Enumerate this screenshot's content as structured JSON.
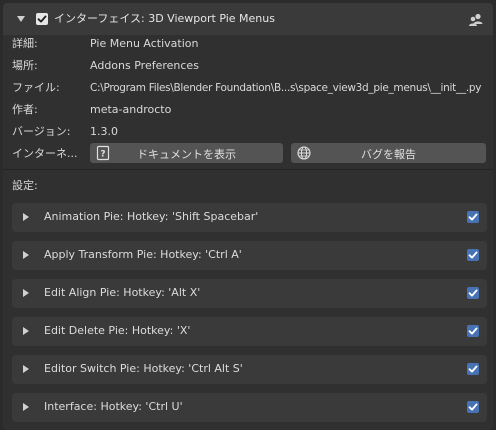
{
  "header": {
    "title": "インターフェイス: 3D Viewport Pie Menus",
    "enabled": true,
    "icon": "user-icon"
  },
  "info": {
    "description_label": "詳細:",
    "description_value": "Pie Menu Activation",
    "location_label": "場所:",
    "location_value": "Addons Preferences",
    "file_label": "ファイル:",
    "file_value": "C:\\Program Files\\Blender Foundation\\B...s\\space_view3d_pie_menus\\__init__.py",
    "author_label": "作者:",
    "author_value": "meta-androcto",
    "version_label": "バージョン:",
    "version_value": "1.3.0",
    "internet_label": "インターネ..."
  },
  "buttons": {
    "docs_label": "ドキュメントを表示",
    "docs_icon": "help-icon",
    "bug_label": "バグを報告",
    "bug_icon": "globe-icon"
  },
  "settings_label": "設定:",
  "submenus": [
    {
      "label": "Animation Pie: Hotkey: 'Shift Spacebar'",
      "checked": true
    },
    {
      "label": "Apply Transform Pie: Hotkey: 'Ctrl A'",
      "checked": true
    },
    {
      "label": "Edit Align Pie: Hotkey: 'Alt X'",
      "checked": true
    },
    {
      "label": "Edit Delete Pie: Hotkey: 'X'",
      "checked": true
    },
    {
      "label": "Editor Switch Pie: Hotkey: 'Ctrl Alt S'",
      "checked": true
    },
    {
      "label": "Interface: Hotkey: 'Ctrl U'",
      "checked": true
    }
  ],
  "colors": {
    "background": "#303030",
    "header": "#3a3a3a",
    "button": "#545454",
    "accent": "#4772b3"
  }
}
